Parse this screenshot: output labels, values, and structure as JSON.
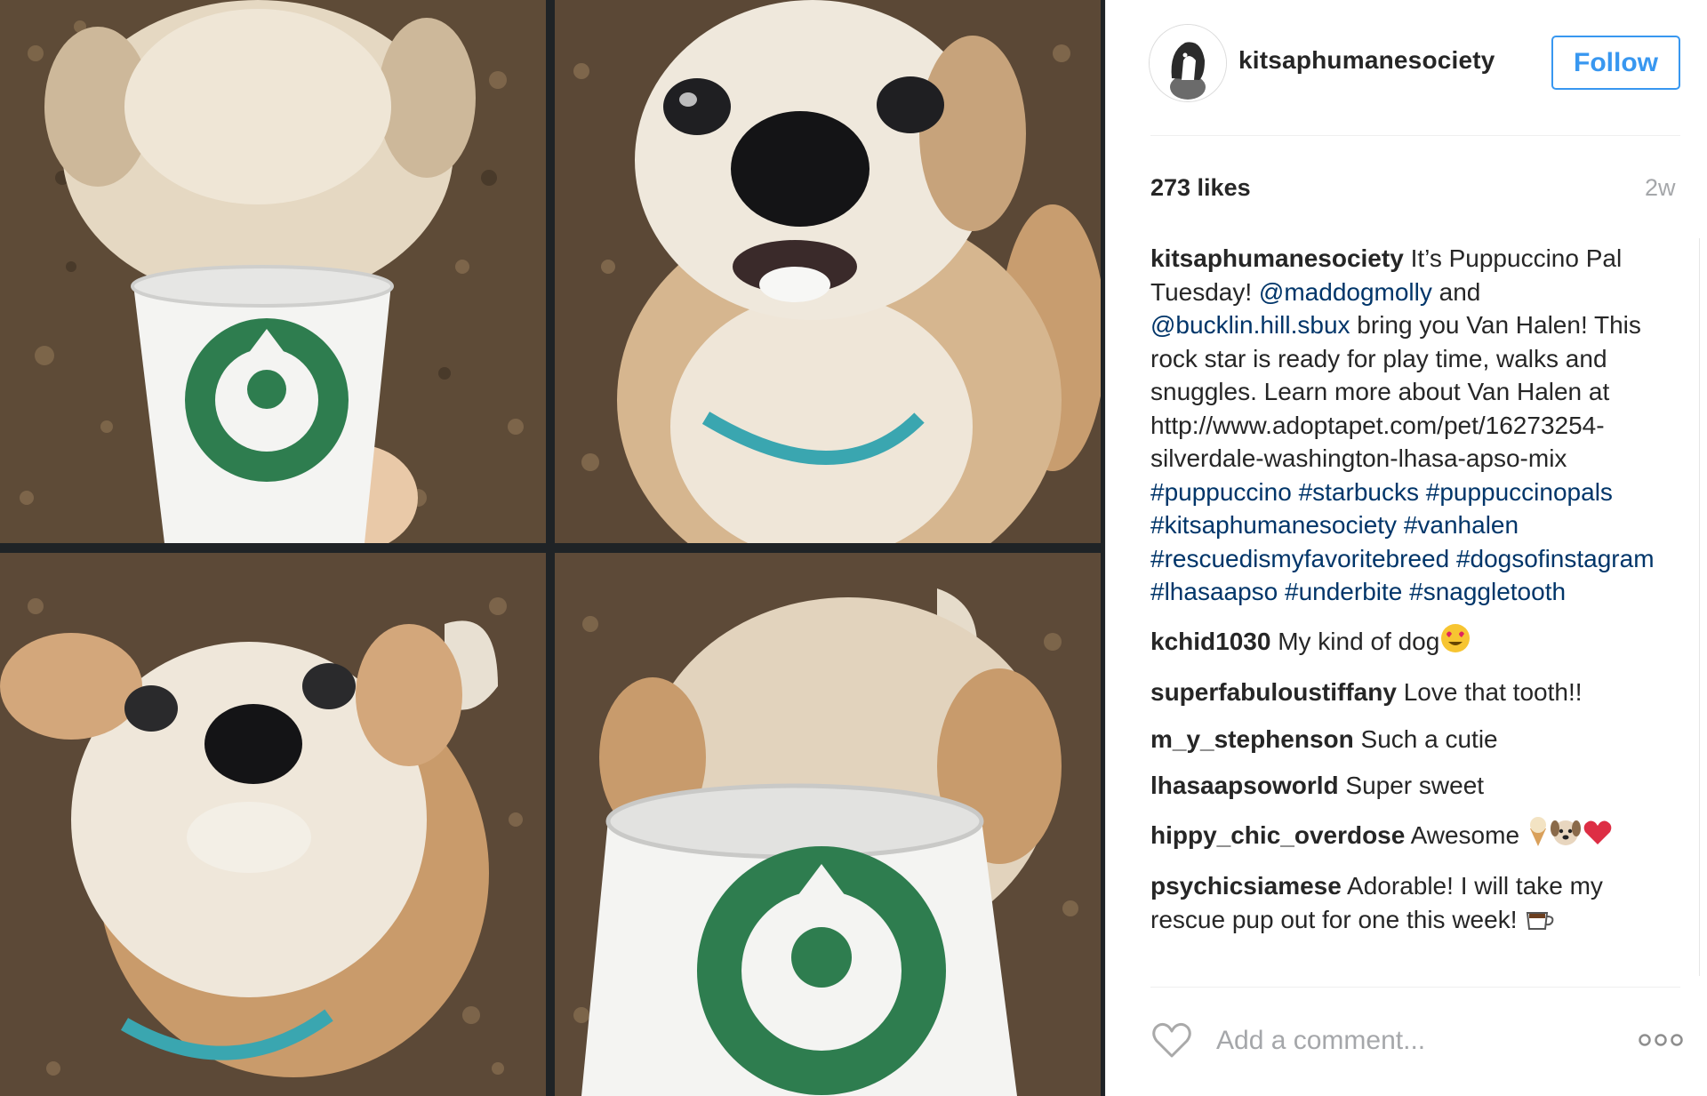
{
  "post": {
    "author": "kitsaphumanesociety",
    "follow_label": "Follow",
    "likes": "273 likes",
    "age": "2w",
    "caption": {
      "user": "kitsaphumanesociety",
      "text_1": "It’s Puppuccino Pal Tuesday! ",
      "mention_1": "@maddogmolly",
      "text_2": " and ",
      "mention_2": "@bucklin.hill.sbux",
      "text_3": " bring you Van Halen! This rock star is ready for play time, walks and snuggles. Learn more about Van Halen at http://www.adoptapet.com/pet/16273254-silverdale-washington-lhasa-apso-mix ",
      "hashtags": "#puppuccino #starbucks #puppuccinopals #kitsaphumanesociety #vanhalen #rescuedismyfavoritebreed #dogsofinstagram #lhasaapso #underbite #snaggletooth"
    },
    "comments": [
      {
        "user": "kchid1030",
        "text": "My kind of dog"
      },
      {
        "user": "superfabuloustiffany",
        "text": "Love that tooth!!"
      },
      {
        "user": "m_y_stephenson",
        "text": "Such a cutie"
      },
      {
        "user": "lhasaapsoworld",
        "text": "Super sweet"
      },
      {
        "user": "hippy_chic_overdose",
        "text": "Awesome "
      },
      {
        "user": "psychicsiamese",
        "text": "Adorable! I will take my rescue pup out for one this week! "
      }
    ],
    "comment_placeholder": "Add a comment...",
    "icons": {
      "heart": "heart-outline-icon",
      "more": "more-options-icon",
      "emoji_heart_eyes": "heart-eyes-emoji",
      "emoji_ice_cream": "ice-cream-emoji",
      "emoji_dog": "dog-face-emoji",
      "emoji_heart": "red-heart-emoji",
      "emoji_coffee": "coffee-emoji"
    },
    "colors": {
      "link": "#003569",
      "follow": "#3897f0",
      "muted": "#a5a7aa",
      "text": "#262626"
    }
  }
}
